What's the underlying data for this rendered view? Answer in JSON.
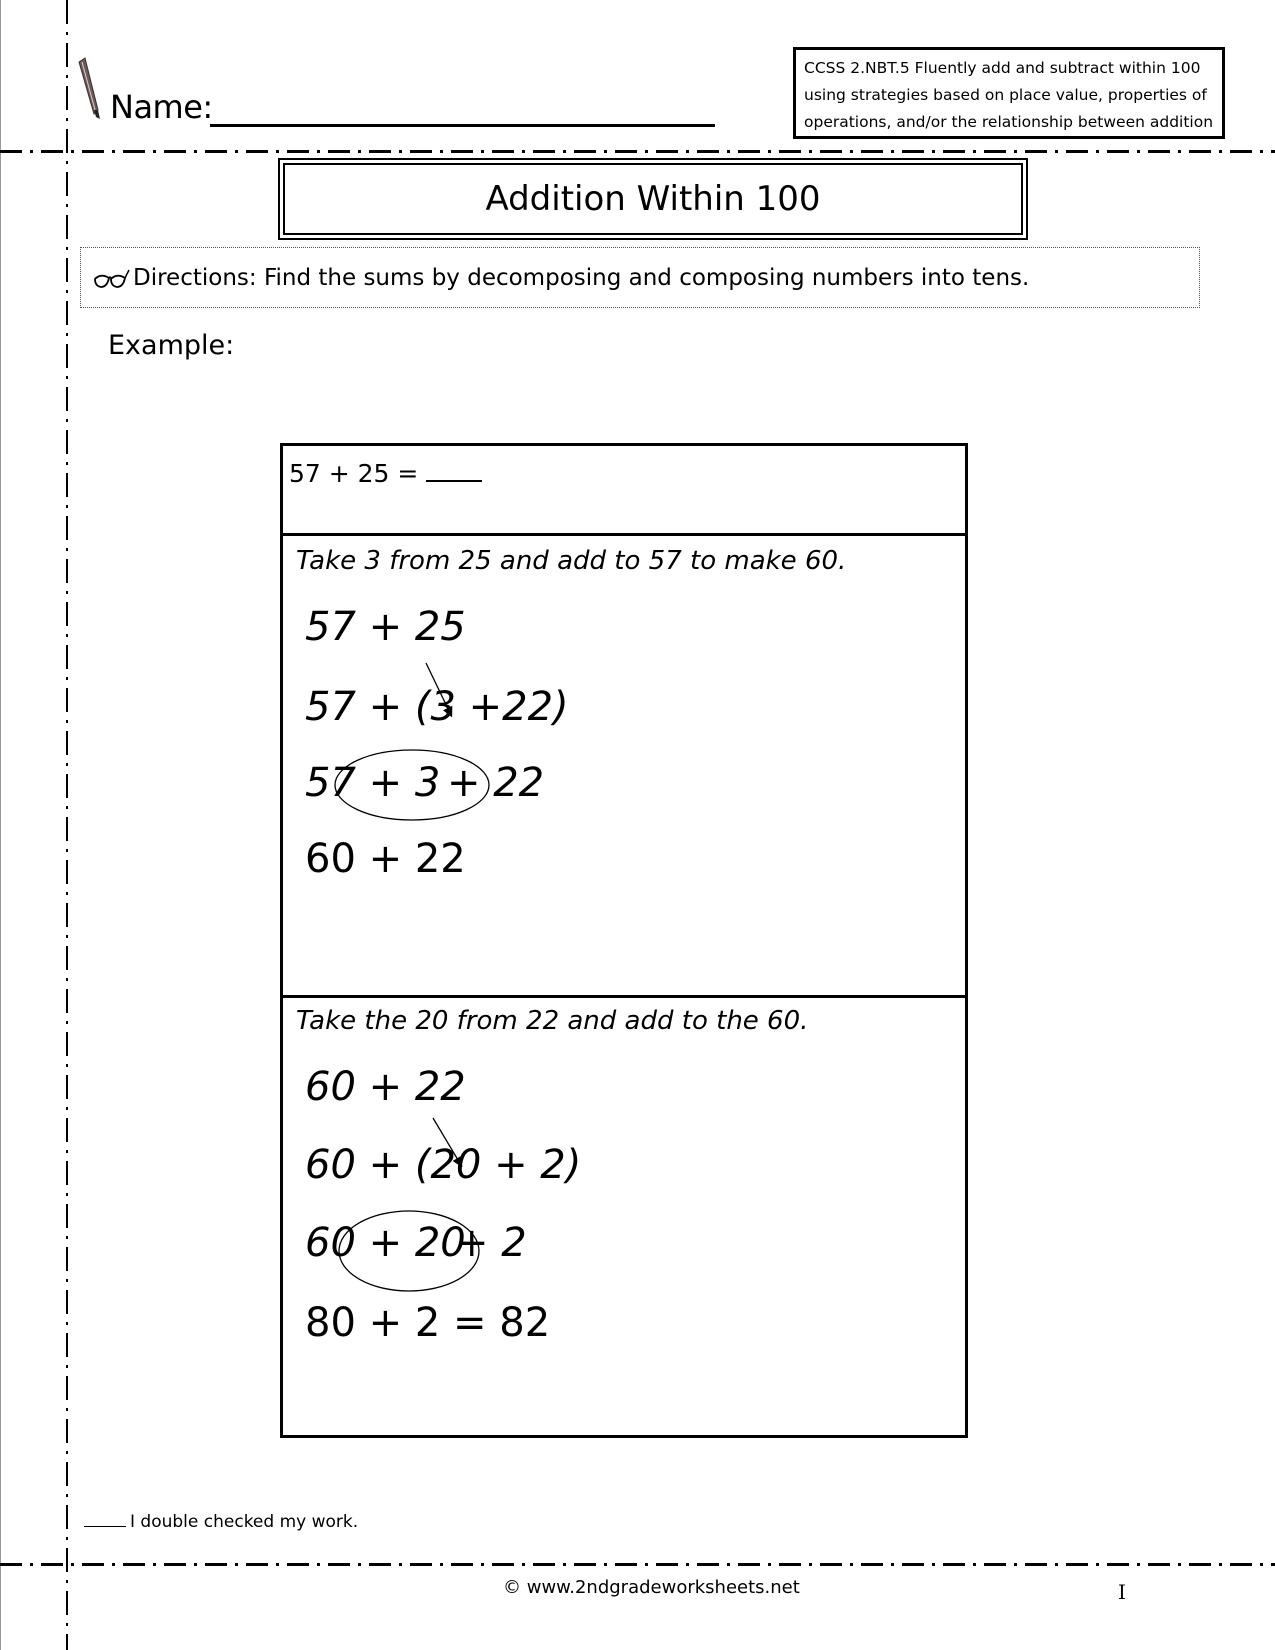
{
  "header": {
    "name_label": "Name:",
    "standard_text": "CCSS 2.NBT.5 Fluently add and subtract within 100 using strategies based on place value, properties of operations, and/or the relationship between addition"
  },
  "title": "Addition Within 100",
  "directions": {
    "icon": "glasses-icon",
    "text": "Directions: Find the sums by decomposing and composing numbers into tens."
  },
  "example_label": "Example:",
  "example": {
    "problem": "57 + 25 =",
    "sections": [
      {
        "hint": "Take 3 from 25 and add to 57 to make 60.",
        "steps": [
          "57 + 25",
          "57 + (3 +22)",
          "57 + 3",
          "+ 22",
          "60 + 22"
        ],
        "circled": "57 + 3"
      },
      {
        "hint": "Take the 20 from 22 and add to the 60.",
        "steps": [
          "60 + 22",
          "60 + (20 + 2)",
          "60 + 20",
          "+ 2",
          "80 + 2 = 82"
        ],
        "circled": "60 + 20"
      }
    ]
  },
  "footer": {
    "checked_text": "I double checked my work.",
    "copyright": "© www.2ndgradeworksheets.net",
    "cursor_glyph": "I"
  }
}
